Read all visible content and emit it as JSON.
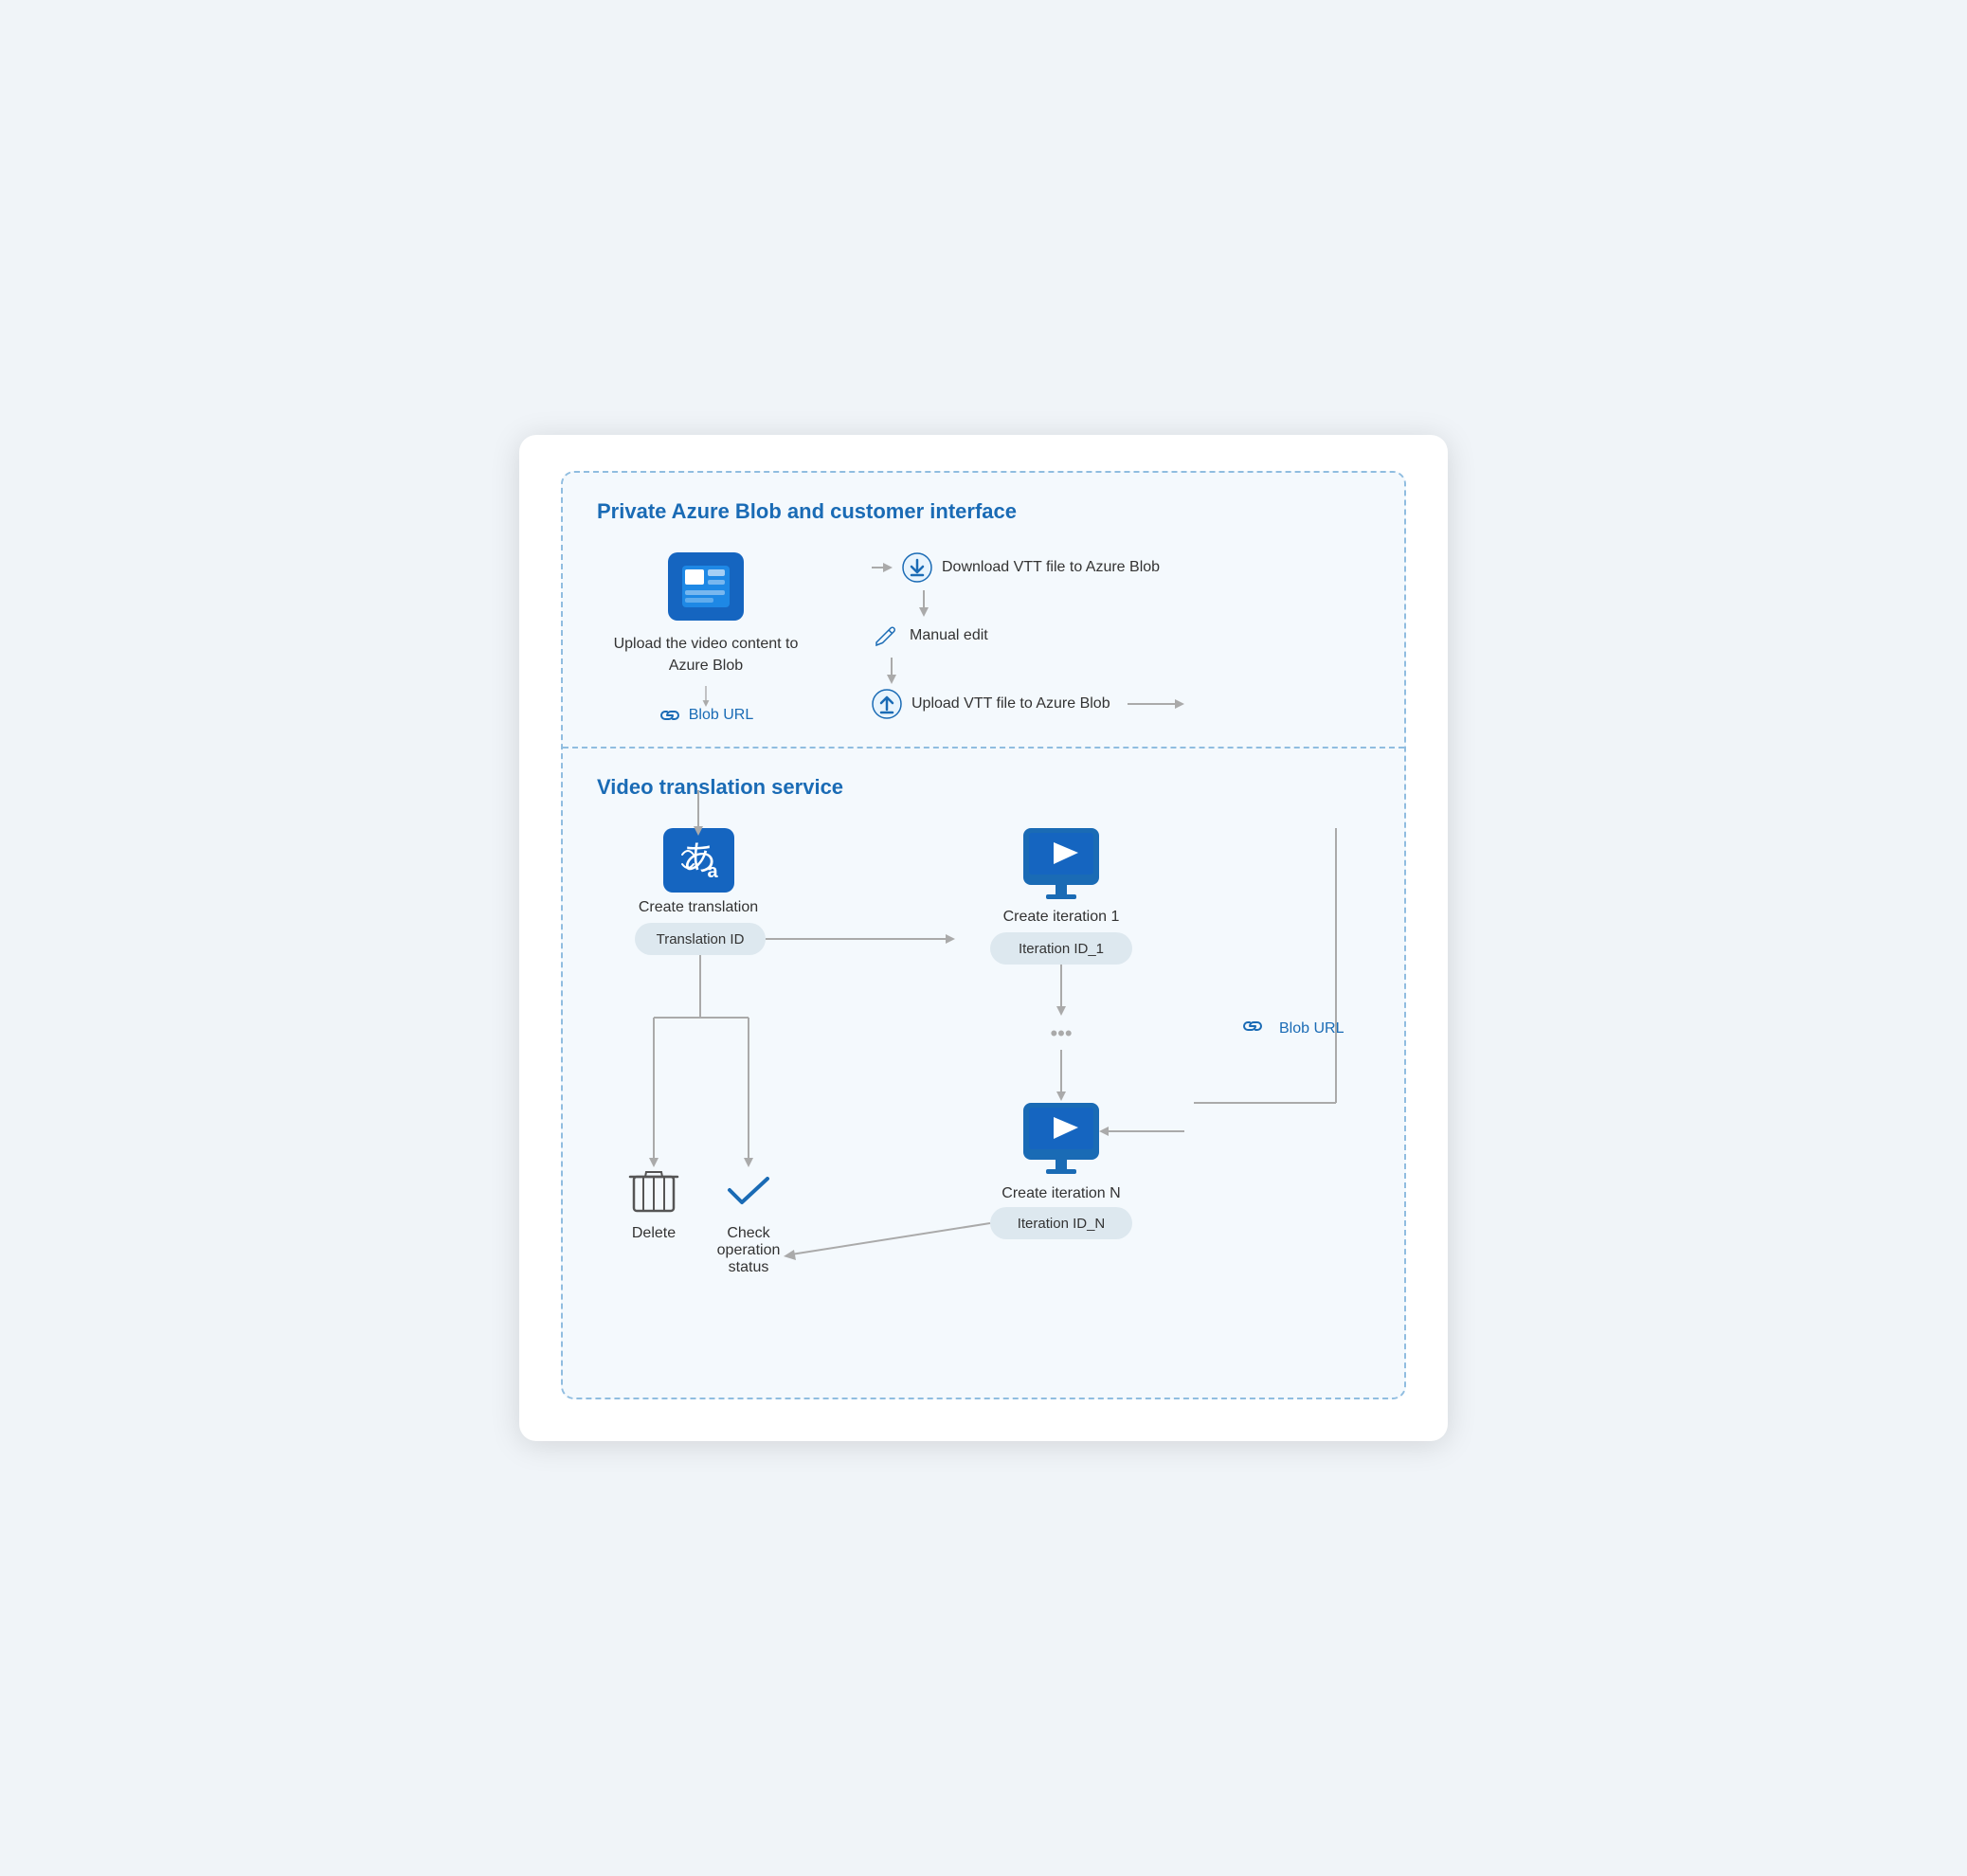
{
  "top_section": {
    "title": "Private Azure Blob and customer interface",
    "left": {
      "upload_label": "Upload the video content to Azure Blob",
      "blob_url_label": "Blob URL"
    },
    "right": {
      "step1": "Download VTT file to Azure Blob",
      "step2": "Manual edit",
      "step3": "Upload VTT file to Azure Blob"
    }
  },
  "bottom_section": {
    "title": "Video translation service",
    "create_translation_label": "Create translation",
    "translation_id_label": "Translation ID",
    "create_iteration1_label": "Create iteration 1",
    "iteration_id1_label": "Iteration ID_1",
    "create_iterationN_label": "Create iteration N",
    "iteration_idN_label": "Iteration ID_N",
    "delete_label": "Delete",
    "check_status_label": "Check operation status",
    "blob_url_label": "Blob URL"
  }
}
